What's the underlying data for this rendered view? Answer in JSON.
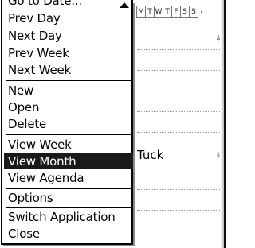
{
  "calendar": {
    "weekdays": [
      "M",
      "T",
      "W",
      "T",
      "F",
      "S",
      "S"
    ],
    "event_title": "Tuck"
  },
  "menu": {
    "items": [
      {
        "label": "Go to Date..."
      },
      {
        "label": "Prev Day"
      },
      {
        "label": "Next Day"
      },
      {
        "label": "Prev Week"
      },
      {
        "label": "Next Week"
      },
      {
        "label": "New"
      },
      {
        "label": "Open"
      },
      {
        "label": "Delete"
      },
      {
        "label": "View Week"
      },
      {
        "label": "View Month"
      },
      {
        "label": "View Agenda"
      },
      {
        "label": "Options"
      },
      {
        "label": "Switch Application"
      },
      {
        "label": "Close"
      }
    ],
    "selected": "View Month"
  },
  "icons": {
    "scroll": "scroll-up-arrow-icon",
    "alarm": "alarm-bell-icon"
  }
}
